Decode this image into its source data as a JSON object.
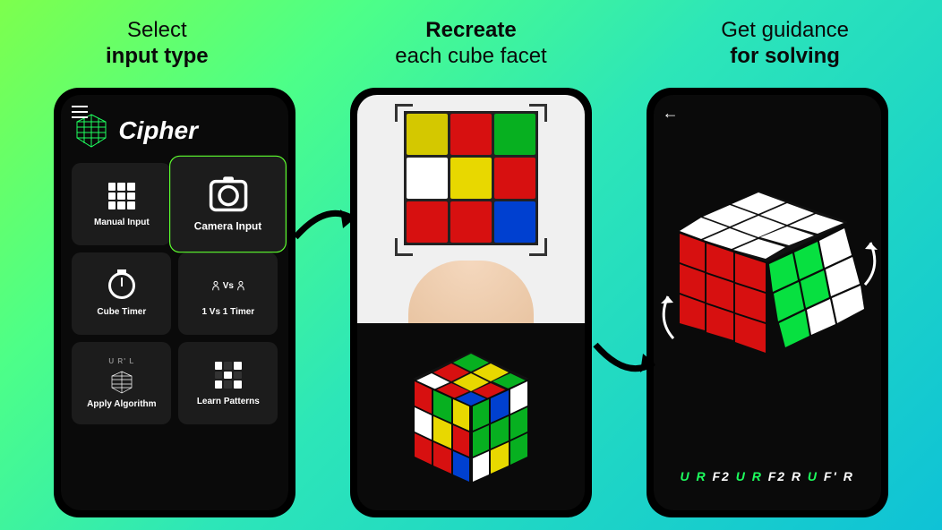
{
  "headers": [
    {
      "line1": "Select",
      "line2": "input type"
    },
    {
      "line1": "Recreate",
      "line2": "each cube facet"
    },
    {
      "line1": "Get guidance",
      "line2": "for solving"
    }
  ],
  "phone1": {
    "app_title": "Cipher",
    "tiles": {
      "manual": "Manual Input",
      "camera": "Camera Input",
      "timer": "Cube Timer",
      "vs": "1 Vs 1 Timer",
      "vs_label": "Vs",
      "algo_label": "U R' L",
      "algo": "Apply Algorithm",
      "patterns": "Learn Patterns"
    }
  },
  "phone2": {
    "scan_face_colors": [
      "#d4c800",
      "#d71010",
      "#07b020",
      "#ffffff",
      "#e8d800",
      "#d71010",
      "#d71010",
      "#d71010",
      "#0040d0"
    ]
  },
  "phone3": {
    "notation_parts": [
      {
        "t": "U R ",
        "c": "g"
      },
      {
        "t": "F2 ",
        "c": "w"
      },
      {
        "t": "U R ",
        "c": "g"
      },
      {
        "t": "F2 R ",
        "c": "w"
      },
      {
        "t": "U ",
        "c": "g"
      },
      {
        "t": "F' R",
        "c": "w"
      }
    ]
  },
  "colors": {
    "accent_green": "#5dff2e"
  }
}
